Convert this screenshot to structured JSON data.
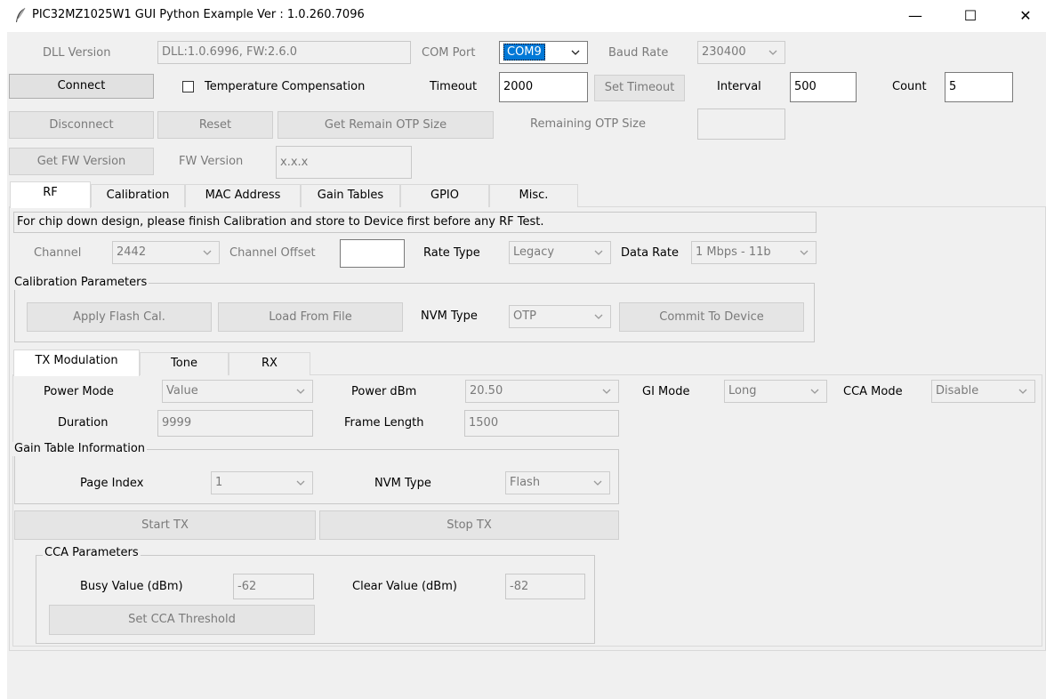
{
  "window": {
    "title": "PIC32MZ1025W1 GUI Python Example Ver : 1.0.260.7096",
    "minimize": "—",
    "maximize": "☐",
    "close": "✕"
  },
  "top": {
    "dll_version_label": "DLL Version",
    "dll_version_value": "DLL:1.0.6996, FW:2.6.0",
    "com_port_label": "COM Port",
    "com_port_value": "COM9",
    "baud_rate_label": "Baud Rate",
    "baud_rate_value": "230400",
    "connect": "Connect",
    "temp_comp": "Temperature Compensation",
    "timeout_label": "Timeout",
    "timeout_value": "2000",
    "set_timeout": "Set Timeout",
    "interval_label": "Interval",
    "interval_value": "500",
    "count_label": "Count",
    "count_value": "5",
    "disconnect": "Disconnect",
    "reset": "Reset",
    "get_remain_otp": "Get Remain OTP Size",
    "remaining_otp_label": "Remaining OTP Size",
    "remaining_otp_value": "",
    "get_fw_version": "Get FW Version",
    "fw_version_label": "FW Version",
    "fw_version_value": "x.x.x"
  },
  "main_tabs": [
    "RF",
    "Calibration",
    "MAC Address",
    "Gain Tables",
    "GPIO",
    "Misc."
  ],
  "rf": {
    "notice": "For chip down design, please finish Calibration and store to Device first before any RF Test.",
    "channel_label": "Channel",
    "channel_value": "2442",
    "channel_offset_label": "Channel Offset",
    "channel_offset_value": "",
    "rate_type_label": "Rate Type",
    "rate_type_value": "Legacy",
    "data_rate_label": "Data Rate",
    "data_rate_value": "1 Mbps - 11b",
    "cal_group_title": "Calibration Parameters",
    "apply_flash_cal": "Apply Flash Cal.",
    "load_from_file": "Load From File",
    "nvm_type_label": "NVM Type",
    "nvm_type_value": "OTP",
    "commit_to_device": "Commit To Device"
  },
  "sub_tabs": [
    "TX Modulation",
    "Tone",
    "RX"
  ],
  "tx": {
    "power_mode_label": "Power Mode",
    "power_mode_value": "Value",
    "power_dbm_label": "Power dBm",
    "power_dbm_value": "20.50",
    "gi_mode_label": "GI Mode",
    "gi_mode_value": "Long",
    "cca_mode_label": "CCA Mode",
    "cca_mode_value": "Disable",
    "duration_label": "Duration",
    "duration_value": "9999",
    "frame_length_label": "Frame Length",
    "frame_length_value": "1500",
    "gain_group_title": "Gain Table Information",
    "page_index_label": "Page Index",
    "page_index_value": "1",
    "nvm_type_label": "NVM Type",
    "nvm_type_value": "Flash",
    "start_tx": "Start TX",
    "stop_tx": "Stop TX",
    "cca_group_title": "CCA Parameters",
    "busy_label": "Busy Value (dBm)",
    "busy_value": "-62",
    "clear_label": "Clear Value (dBm)",
    "clear_value": "-82",
    "set_cca": "Set CCA Threshold"
  }
}
